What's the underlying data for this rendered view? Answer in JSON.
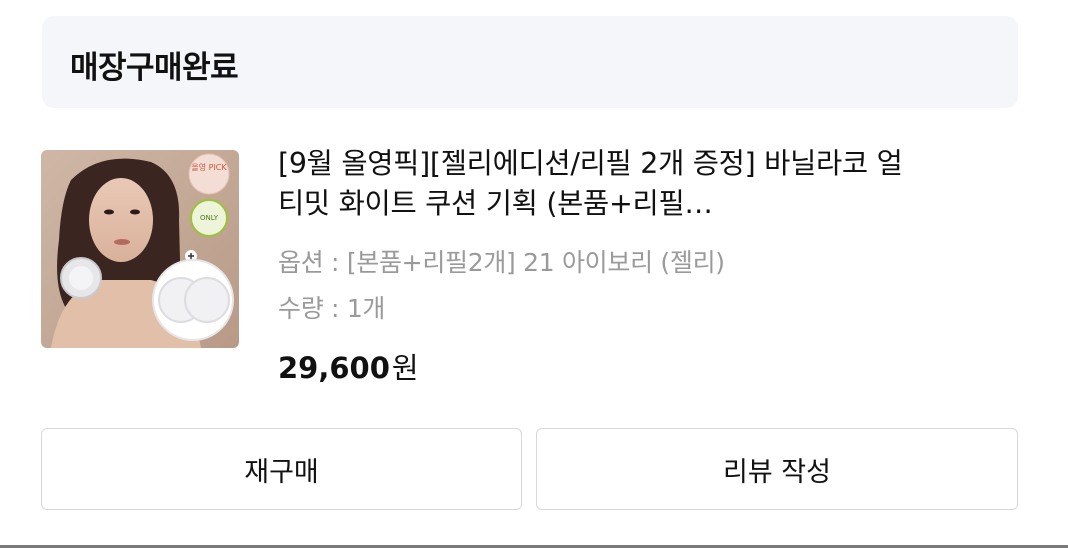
{
  "order": {
    "status": "매장구매완료"
  },
  "product": {
    "name": "[9월 올영픽][젤리에디션/리필 2개 증정] 바닐라코 얼티밋 화이트 쿠션 기획 (본품+리필…",
    "option": "옵션 : [본품+리필2개] 21 아이보리 (젤리)",
    "quantity": "수량 : 1개",
    "price": "29,600",
    "currency": "원",
    "image_badges": {
      "badge_1": "올영 PICK",
      "badge_2": "ONLY"
    }
  },
  "actions": {
    "rebuy_label": "재구매",
    "review_label": "리뷰 작성"
  },
  "colors": {
    "status_bg": "#f5f6fa",
    "text_primary": "#111111",
    "text_secondary": "#9a9a9a",
    "button_border": "#d8d8d8"
  }
}
